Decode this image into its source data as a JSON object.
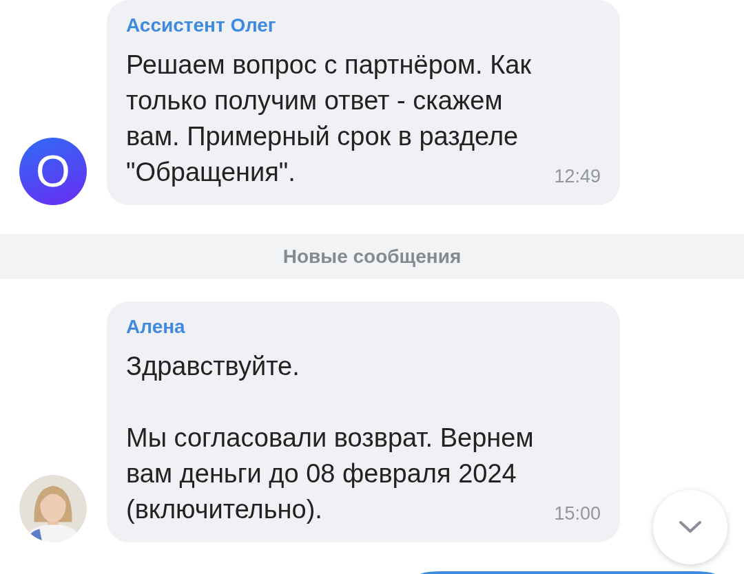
{
  "messages": [
    {
      "kind": "incoming",
      "avatar": {
        "kind": "initial",
        "initial": "О"
      },
      "author": "Ассистент Олег",
      "text": "Решаем вопрос с партнёром. Как\nтолько получим ответ - скажем\nвам. Примерный срок в разделе\n\"Обращения\".",
      "time": "12:49"
    },
    {
      "kind": "divider",
      "text": "Новые сообщения"
    },
    {
      "kind": "incoming",
      "author": "Алена",
      "text": "Здравствуйте.\n\nМы согласовали возврат. Вернем\nвам деньги до 08 февраля 2024\n(включительно).",
      "time": "15:00"
    },
    {
      "kind": "outgoing"
    }
  ],
  "scroll_down_button": {
    "visible": true
  }
}
